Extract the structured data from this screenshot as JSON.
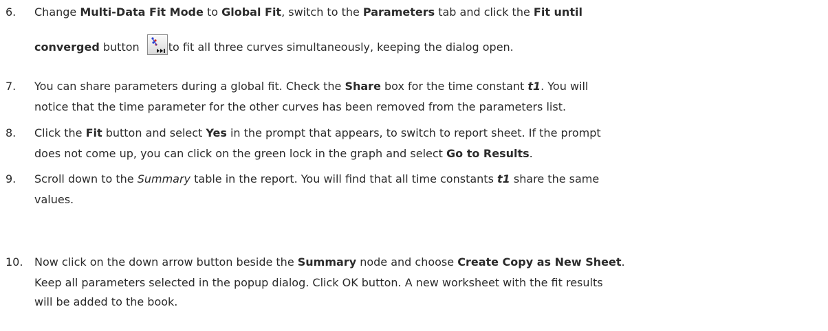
{
  "steps": [
    {
      "number": "6.",
      "line1": {
        "a": "Change ",
        "b": "Multi-Data Fit Mode",
        "c": " to ",
        "d": "Global Fit",
        "e": ", switch to the ",
        "f": "Parameters",
        "g": " tab and click the ",
        "h": "Fit until"
      },
      "line2": {
        "a": "converged",
        "b": " button ",
        "c": "to fit all three curves simultaneously, keeping the dialog open."
      },
      "icon": "fit-until-converged-icon"
    },
    {
      "number": "7.",
      "line1": {
        "a": "You can share parameters during a global fit. Check the ",
        "b": "Share",
        "c": " box for the time constant ",
        "d": "t1",
        "e": ". You will"
      },
      "line2": {
        "a": "notice that the time parameter for the other curves has been removed from the parameters list."
      }
    },
    {
      "number": "8.",
      "line1": {
        "a": "Click the ",
        "b": "Fit",
        "c": " button and select ",
        "d": "Yes",
        "e": " in the prompt that appears, to switch to report sheet. If the prompt"
      },
      "line2": {
        "a": "does not come up, you can click on the green lock in the graph and select ",
        "b": "Go to Results",
        "c": "."
      }
    },
    {
      "number": "9.",
      "line1": {
        "a": "Scroll down to the ",
        "b": "Summary",
        "c": " table in the report. You will find that all time constants ",
        "d": "t1",
        "e": " share the same"
      },
      "line2": {
        "a": "values."
      }
    },
    {
      "number": "10.",
      "line1": {
        "a": "Now click on the down arrow button beside the ",
        "b": "Summary",
        "c": " node and choose ",
        "d": "Create Copy as New Sheet",
        "e": "."
      },
      "line2": {
        "a": "Keep all parameters selected in the popup dialog. Click OK button. A new worksheet with the fit results"
      },
      "line3": {
        "a": "will be added to the book."
      }
    }
  ]
}
